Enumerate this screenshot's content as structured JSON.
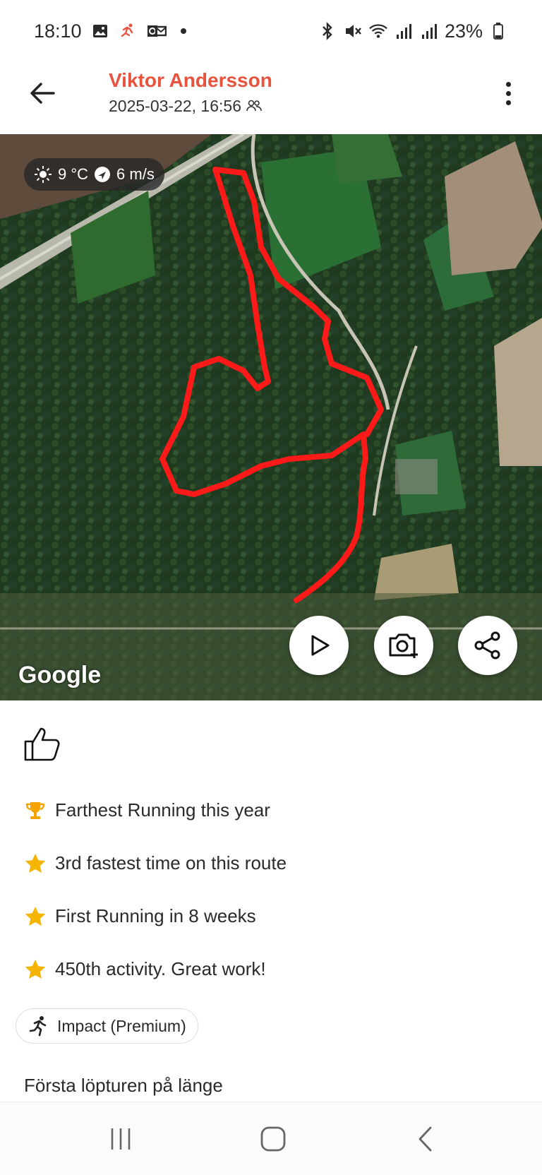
{
  "status_bar": {
    "time": "18:10",
    "battery": "23%",
    "left_icons": [
      "gallery-icon",
      "strava-running-icon",
      "outlook-icon",
      "notification-dot"
    ],
    "right_icons": [
      "bluetooth-icon",
      "mute-icon",
      "wifi-icon",
      "signal-icon",
      "signal-icon-2",
      "battery-icon"
    ]
  },
  "header": {
    "athlete_name": "Viktor Andersson",
    "date": "2025-03-22, 16:56",
    "accent_color": "#e8533e"
  },
  "map": {
    "weather": {
      "temperature": "9 °C",
      "wind": "6 m/s"
    },
    "google_label": "Google",
    "route_color": "#ff1a1a",
    "buttons": {
      "play": "play-icon",
      "camera": "add-photo-icon",
      "share": "share-icon"
    }
  },
  "achievements": [
    {
      "icon": "trophy-icon",
      "text": "Farthest Running this year"
    },
    {
      "icon": "star-icon",
      "text": "3rd fastest time on this route"
    },
    {
      "icon": "star-icon",
      "text": "First Running in 8 weeks"
    },
    {
      "icon": "star-icon",
      "text": "450th activity. Great work!"
    }
  ],
  "impact_chip": {
    "label": "Impact (Premium)"
  },
  "description": "Första löpturen på länge"
}
